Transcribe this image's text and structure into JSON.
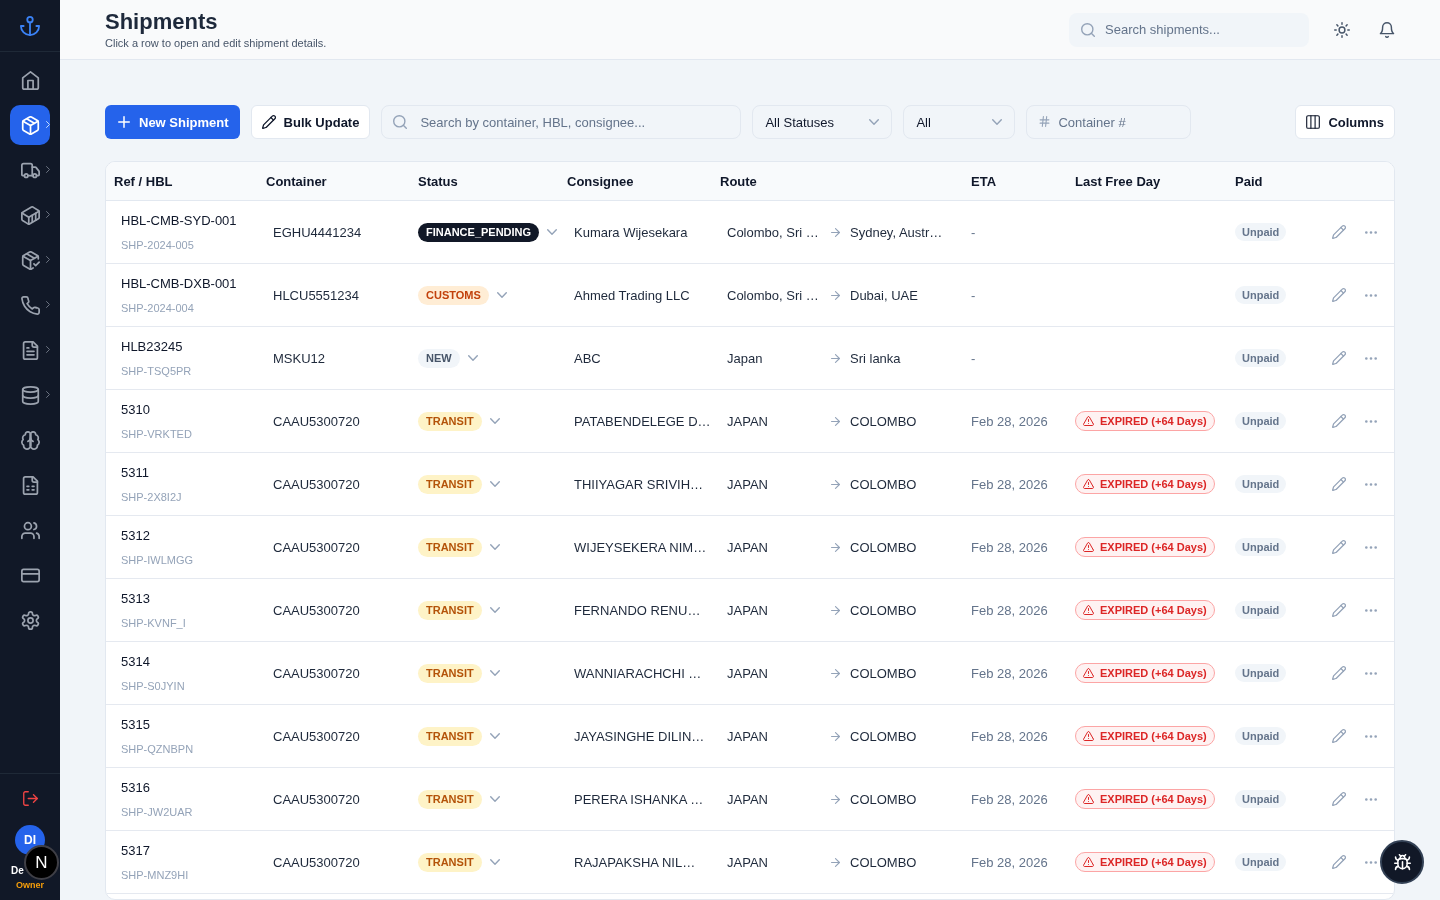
{
  "sidebar": {
    "nav": [
      {
        "selected": false,
        "expandable": false
      },
      {
        "selected": true,
        "expandable": true
      },
      {
        "selected": false,
        "expandable": true
      },
      {
        "selected": false,
        "expandable": true
      },
      {
        "selected": false,
        "expandable": true
      },
      {
        "selected": false,
        "expandable": true
      },
      {
        "selected": false,
        "expandable": true
      },
      {
        "selected": false,
        "expandable": true
      },
      {
        "selected": false,
        "expandable": false
      },
      {
        "selected": false,
        "expandable": false
      },
      {
        "selected": false,
        "expandable": false
      },
      {
        "selected": false,
        "expandable": false
      },
      {
        "selected": false,
        "expandable": false
      }
    ],
    "user": {
      "initials": "DI",
      "name": "De",
      "role": "Owner"
    }
  },
  "header": {
    "title": "Shipments",
    "subtitle": "Click a row to open and edit shipment details.",
    "search": {
      "placeholder": "Search shipments..."
    }
  },
  "toolbar": {
    "new_button": "New Shipment",
    "bulk_button": "Bulk Update",
    "search": {
      "placeholder": "Search by container, HBL, consignee..."
    },
    "status_select": {
      "value": "All Statuses"
    },
    "filter_select": {
      "value": "All"
    },
    "container_field": {
      "placeholder": "Container #"
    },
    "columns_button": "Columns"
  },
  "table": {
    "columns": [
      "Ref / HBL",
      "Container",
      "Status",
      "Consignee",
      "Route",
      "ETA",
      "Last Free Day",
      "Paid"
    ],
    "rows": [
      {
        "ref": "HBL-CMB-SYD-001",
        "shipment_id": "SHP-2024-005",
        "container": "EGHU4441234",
        "status": {
          "label": "FINANCE_PENDING",
          "kind": "finance"
        },
        "consignee": "Kumara Wijesekara",
        "origin": "Colombo, Sri …",
        "destination": "Sydney, Austr…",
        "eta": "-",
        "paid": "Unpaid"
      },
      {
        "ref": "HBL-CMB-DXB-001",
        "shipment_id": "SHP-2024-004",
        "container": "HLCU5551234",
        "status": {
          "label": "CUSTOMS",
          "kind": "customs"
        },
        "consignee": "Ahmed Trading LLC",
        "origin": "Colombo, Sri …",
        "destination": "Dubai, UAE",
        "eta": "-",
        "paid": "Unpaid"
      },
      {
        "ref": "HLB23245",
        "shipment_id": "SHP-TSQ5PR",
        "container": "MSKU12",
        "status": {
          "label": "NEW",
          "kind": "new"
        },
        "consignee": "ABC",
        "origin": "Japan",
        "destination": "Sri lanka",
        "eta": "-",
        "paid": "Unpaid"
      },
      {
        "ref": "5310",
        "shipment_id": "SHP-VRKTED",
        "container": "CAAU5300720",
        "status": {
          "label": "TRANSIT",
          "kind": "transit"
        },
        "consignee": "PATABENDELEGE D…",
        "origin": "JAPAN",
        "destination": "COLOMBO",
        "eta": "Feb 28, 2026",
        "last_free_day": "EXPIRED (+64 Days)",
        "paid": "Unpaid"
      },
      {
        "ref": "5311",
        "shipment_id": "SHP-2X8I2J",
        "container": "CAAU5300720",
        "status": {
          "label": "TRANSIT",
          "kind": "transit"
        },
        "consignee": "THIIYAGAR SRIVIH…",
        "origin": "JAPAN",
        "destination": "COLOMBO",
        "eta": "Feb 28, 2026",
        "last_free_day": "EXPIRED (+64 Days)",
        "paid": "Unpaid"
      },
      {
        "ref": "5312",
        "shipment_id": "SHP-IWLMGG",
        "container": "CAAU5300720",
        "status": {
          "label": "TRANSIT",
          "kind": "transit"
        },
        "consignee": "WIJEYSEKERA NIM…",
        "origin": "JAPAN",
        "destination": "COLOMBO",
        "eta": "Feb 28, 2026",
        "last_free_day": "EXPIRED (+64 Days)",
        "paid": "Unpaid"
      },
      {
        "ref": "5313",
        "shipment_id": "SHP-KVNF_I",
        "container": "CAAU5300720",
        "status": {
          "label": "TRANSIT",
          "kind": "transit"
        },
        "consignee": "FERNANDO RENU…",
        "origin": "JAPAN",
        "destination": "COLOMBO",
        "eta": "Feb 28, 2026",
        "last_free_day": "EXPIRED (+64 Days)",
        "paid": "Unpaid"
      },
      {
        "ref": "5314",
        "shipment_id": "SHP-S0JYIN",
        "container": "CAAU5300720",
        "status": {
          "label": "TRANSIT",
          "kind": "transit"
        },
        "consignee": "WANNIARACHCHI …",
        "origin": "JAPAN",
        "destination": "COLOMBO",
        "eta": "Feb 28, 2026",
        "last_free_day": "EXPIRED (+64 Days)",
        "paid": "Unpaid"
      },
      {
        "ref": "5315",
        "shipment_id": "SHP-QZNBPN",
        "container": "CAAU5300720",
        "status": {
          "label": "TRANSIT",
          "kind": "transit"
        },
        "consignee": "JAYASINGHE DILIN…",
        "origin": "JAPAN",
        "destination": "COLOMBO",
        "eta": "Feb 28, 2026",
        "last_free_day": "EXPIRED (+64 Days)",
        "paid": "Unpaid"
      },
      {
        "ref": "5316",
        "shipment_id": "SHP-JW2UAR",
        "container": "CAAU5300720",
        "status": {
          "label": "TRANSIT",
          "kind": "transit"
        },
        "consignee": "PERERA ISHANKA …",
        "origin": "JAPAN",
        "destination": "COLOMBO",
        "eta": "Feb 28, 2026",
        "last_free_day": "EXPIRED (+64 Days)",
        "paid": "Unpaid"
      },
      {
        "ref": "5317",
        "shipment_id": "SHP-MNZ9HI",
        "container": "CAAU5300720",
        "status": {
          "label": "TRANSIT",
          "kind": "transit"
        },
        "consignee": "RAJAPAKSHA NIL…",
        "origin": "JAPAN",
        "destination": "COLOMBO",
        "eta": "Feb 28, 2026",
        "last_free_day": "EXPIRED (+64 Days)",
        "paid": "Unpaid"
      }
    ]
  },
  "overlays": {
    "dev_badge": "N"
  }
}
